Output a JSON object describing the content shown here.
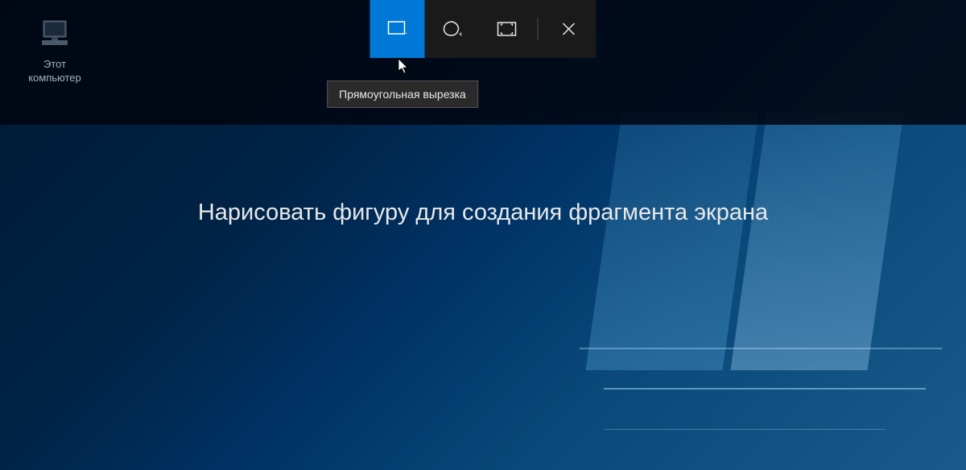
{
  "desktop": {
    "icon_label": "Этот\nкомпьютер"
  },
  "toolbar": {
    "modes": [
      {
        "name": "rectangular",
        "active": true
      },
      {
        "name": "freeform",
        "active": false
      },
      {
        "name": "fullscreen",
        "active": false
      }
    ],
    "close_label": "✕"
  },
  "tooltip": {
    "text": "Прямоугольная вырезка"
  },
  "instruction": {
    "text": "Нарисовать фигуру для создания фрагмента экрана"
  }
}
